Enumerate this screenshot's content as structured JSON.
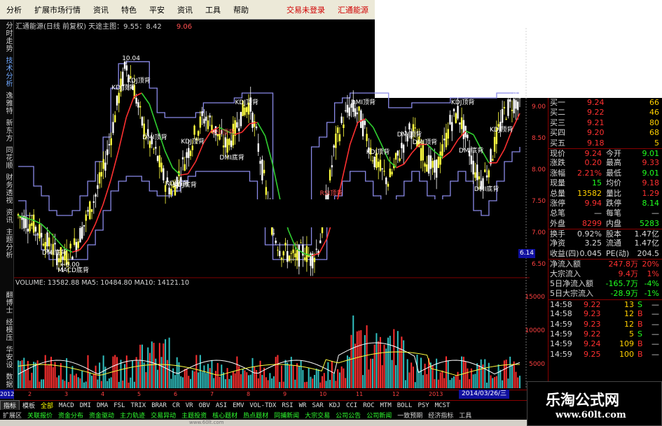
{
  "menubar": {
    "items": [
      "分析",
      "扩展市场行情",
      "资讯",
      "特色",
      "平安",
      "资讯",
      "工具",
      "帮助"
    ],
    "status_items": [
      "交易未登录",
      "汇通能源"
    ]
  },
  "left_strip": {
    "top_tabs": [
      "分时走势",
      "技术分析",
      "逸雅特",
      "新东方",
      "同花顺",
      "财务透视",
      "资讯",
      "主题分析"
    ],
    "bottom_tabs": [
      "翻博士",
      "经模压",
      "华安设",
      "数据"
    ]
  },
  "chart": {
    "title": "汇通能源(日线 前复权) 天途主图：9.55：8.42",
    "title_value": "9.06",
    "high_label": "10.04",
    "low_label": "6.00",
    "signals": [
      "KDJ顶背",
      "KDJ顶背",
      "DMI顶背",
      "KDJ顶背",
      "KDJ顶背",
      "RSI顶背",
      "KDJ顶背",
      "DMI底背",
      "KDJ底背",
      "DMI底背",
      "MACD底背",
      "KDJ顶背",
      "DMI顶背",
      "RSI顶背",
      "DMI顶背",
      "KDJ顶背",
      "DMI顶背",
      "DMI底背",
      "DMI底背",
      "KDJ顶背"
    ],
    "yaxis_ticks": [
      "9.00",
      "8.50",
      "8.00",
      "7.50",
      "7.00",
      "6.50"
    ],
    "current_price": "6.14"
  },
  "chart_data": {
    "type": "line",
    "note_series": [
      "candles",
      "MA-red",
      "MA-green",
      "channel-upper",
      "channel-lower"
    ],
    "price_path": [
      6.9,
      6.8,
      6.7,
      6.5,
      6.3,
      6.1,
      6.0,
      6.2,
      6.5,
      6.9,
      7.3,
      7.8,
      8.5,
      9.3,
      10.0,
      9.5,
      8.8,
      8.4,
      8.1,
      7.6,
      7.4,
      7.8,
      8.2,
      8.6,
      8.9,
      8.8,
      8.5,
      8.3,
      8.6,
      9.0,
      9.2,
      8.4,
      7.5,
      6.6,
      6.2,
      6.1,
      6.0,
      6.2,
      6.0,
      6.3,
      7.2,
      8.3,
      8.8,
      9.1,
      9.0,
      8.6,
      8.1,
      7.8,
      7.6,
      8.0,
      8.4,
      8.7,
      8.3,
      8.0,
      7.8,
      8.2,
      8.8,
      9.0,
      8.5,
      7.9,
      7.6,
      7.9,
      8.5,
      9.0,
      9.2,
      9.24
    ],
    "upper_path": [
      7.9,
      7.9,
      7.5,
      7.3,
      7.0,
      6.9,
      6.9,
      7.0,
      7.3,
      7.6,
      8.0,
      8.5,
      9.5,
      10.0,
      10.04,
      10.04,
      10.04,
      9.5,
      9.0,
      8.9,
      8.9,
      8.9,
      8.9,
      9.0,
      9.2,
      9.2,
      9.2,
      9.2,
      9.3,
      9.4,
      9.4,
      9.4,
      9.4,
      6.3,
      6.3,
      6.3,
      6.3,
      6.3,
      8.3,
      8.5,
      8.8,
      9.2,
      9.3,
      9.4,
      9.4,
      9.4,
      9.4,
      9.4,
      9.1,
      9.1,
      9.1,
      9.2,
      9.2,
      9.2,
      9.2,
      9.2,
      9.3,
      9.3,
      9.3,
      9.3,
      9.3,
      9.3,
      9.4,
      9.4,
      9.4,
      9.4
    ],
    "lower_path": [
      7.2,
      6.9,
      6.5,
      6.2,
      6.0,
      6.0,
      6.0,
      6.0,
      6.0,
      6.3,
      6.6,
      7.0,
      7.4,
      7.6,
      7.7,
      7.7,
      7.6,
      7.4,
      7.3,
      7.3,
      7.4,
      7.6,
      7.7,
      7.8,
      7.8,
      7.8,
      7.8,
      7.8,
      7.8,
      7.8,
      7.6,
      7.0,
      6.3,
      6.0,
      6.0,
      6.0,
      6.0,
      6.0,
      6.0,
      6.0,
      6.8,
      7.3,
      7.6,
      7.8,
      7.8,
      7.6,
      7.3,
      7.1,
      7.0,
      7.3,
      7.6,
      7.8,
      7.6,
      7.3,
      7.1,
      7.3,
      7.6,
      7.8,
      7.6,
      7.0,
      6.9,
      7.2,
      7.6,
      8.0,
      8.2,
      8.3
    ],
    "ylim": [
      5.8,
      10.3
    ],
    "volume": {
      "title": "VOLUME: 13582.88  MA5: 10484.80  MA10: 14121.10",
      "yaxis_ticks": [
        "15000",
        "10000",
        "5000"
      ]
    }
  },
  "quotes": {
    "bids": [
      {
        "label": "买一",
        "price": "9.24",
        "vol": "66"
      },
      {
        "label": "买二",
        "price": "9.22",
        "vol": "46"
      },
      {
        "label": "买三",
        "price": "9.21",
        "vol": "80"
      },
      {
        "label": "买四",
        "price": "9.20",
        "vol": "68"
      },
      {
        "label": "买五",
        "price": "9.18",
        "vol": "5"
      }
    ],
    "stats": [
      {
        "l1": "现价",
        "v1": "9.24",
        "c1": "or",
        "l2": "今开",
        "v2": "9.01",
        "c2": "og"
      },
      {
        "l1": "涨跌",
        "v1": "0.20",
        "c1": "or",
        "l2": "最高",
        "v2": "9.33",
        "c2": "or"
      },
      {
        "l1": "涨幅",
        "v1": "2.21%",
        "c1": "or",
        "l2": "最低",
        "v2": "9.01",
        "c2": "og"
      },
      {
        "l1": "现量",
        "v1": "15",
        "c1": "og",
        "l2": "均价",
        "v2": "9.18",
        "c2": "or"
      },
      {
        "l1": "总量",
        "v1": "13582",
        "c1": "oy",
        "l2": "量比",
        "v2": "1.29",
        "c2": "or"
      },
      {
        "l1": "涨停",
        "v1": "9.94",
        "c1": "or",
        "l2": "跌停",
        "v2": "8.14",
        "c2": "og"
      },
      {
        "l1": "总笔",
        "v1": "—",
        "c1": "ow",
        "l2": "每笔",
        "v2": "—",
        "c2": "ow"
      },
      {
        "l1": "外盘",
        "v1": "8299",
        "c1": "or",
        "l2": "内盘",
        "v2": "5283",
        "c2": "og"
      },
      {
        "l1": "换手",
        "v1": "0.92%",
        "c1": "ow",
        "l2": "股本",
        "v2": "1.47亿",
        "c2": "ow"
      },
      {
        "l1": "净资",
        "v1": "3.25",
        "c1": "ow",
        "l2": "流通",
        "v2": "1.47亿",
        "c2": "ow"
      },
      {
        "l1": "收益(四)",
        "v1": "0.045",
        "c1": "ow",
        "l2": "PE(动)",
        "v2": "204.5",
        "c2": "ow"
      }
    ],
    "flows": [
      {
        "label": "净流入额",
        "v1": "247.8万",
        "c1": "or",
        "v2": "20%",
        "c2": "or"
      },
      {
        "label": "大宗流入",
        "v1": "9.4万",
        "c1": "or",
        "v2": "1%",
        "c2": "or"
      },
      {
        "label": "5日净流入额",
        "v1": "-165.7万",
        "c1": "og",
        "v2": "-4%",
        "c2": "og"
      },
      {
        "label": "5日大宗流入",
        "v1": "-28.9万",
        "c1": "og",
        "v2": "-1%",
        "c2": "og"
      }
    ],
    "ticks": [
      {
        "t": "14:58",
        "p": "9.22",
        "v": "13",
        "s": "S",
        "sc": "og",
        "n": "—"
      },
      {
        "t": "14:58",
        "p": "9.23",
        "v": "12",
        "s": "B",
        "sc": "or",
        "n": "—"
      },
      {
        "t": "14:59",
        "p": "9.23",
        "v": "12",
        "s": "B",
        "sc": "or",
        "n": "—"
      },
      {
        "t": "14:59",
        "p": "9.22",
        "v": "5",
        "s": "S",
        "sc": "og",
        "n": "—"
      },
      {
        "t": "14:59",
        "p": "9.24",
        "v": "109",
        "s": "B",
        "sc": "or",
        "n": "—"
      },
      {
        "t": "14:59",
        "p": "9.25",
        "v": "100",
        "s": "B",
        "sc": "or",
        "n": "—"
      }
    ]
  },
  "xaxis": {
    "left_date": "2012年",
    "ticks": [
      "2",
      "3",
      "4",
      "5",
      "6",
      "7",
      "8",
      "9",
      "10",
      "11",
      "12",
      "2013",
      "2",
      "3"
    ],
    "date_flag": "2014/03/26/三"
  },
  "indicator_tabs": [
    "指标",
    "模板",
    "全部",
    "MACD",
    "DMI",
    "DMA",
    "FSL",
    "TRIX",
    "BRAR",
    "CR",
    "VR",
    "OBV",
    "ASI",
    "EMV",
    "VOL-TDX",
    "RSI",
    "WR",
    "SAR",
    "KDJ",
    "CCI",
    "ROC",
    "MTM",
    "BOLL",
    "PSY",
    "MCST"
  ],
  "function_tabs": [
    "扩展区",
    "关联报价",
    "资金分布",
    "资金驱动",
    "主力轨迹",
    "交易异动",
    "主题投资",
    "核心题材",
    "热点题材",
    "同捕新闻",
    "大宗交易",
    "公司公告",
    "公司新闻",
    "一致预期",
    "经济指标",
    "工具"
  ],
  "watermark": {
    "line1": "乐淘公式网",
    "line2": "www.60lt.com"
  },
  "caption": "www.60lt.com"
}
